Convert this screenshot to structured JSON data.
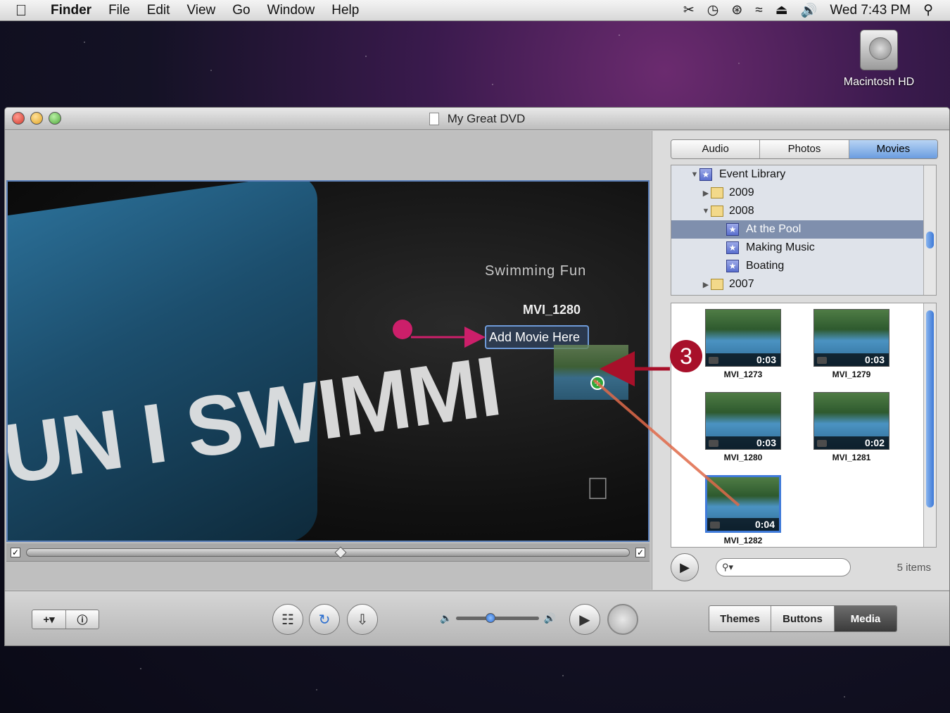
{
  "menubar": {
    "app": "Finder",
    "items": [
      "File",
      "Edit",
      "View",
      "Go",
      "Window",
      "Help"
    ],
    "clock": "Wed 7:43 PM"
  },
  "desktop": {
    "disk_label": "Macintosh HD"
  },
  "window": {
    "title": "My Great DVD"
  },
  "preview": {
    "menu_title": "Swimming Fun",
    "menu_item": "MVI_1280",
    "drop_zone": "Add Movie Here",
    "theme_text": "UN I SWIMMI"
  },
  "media": {
    "tabs": [
      "Audio",
      "Photos",
      "Movies"
    ],
    "active_tab": "Movies",
    "tree": {
      "root": "Event Library",
      "y2009": "2009",
      "y2008": "2008",
      "events": [
        "At the Pool",
        "Making Music",
        "Boating"
      ],
      "y2007": "2007"
    },
    "movies": [
      {
        "name": "MVI_1273",
        "duration": "0:03"
      },
      {
        "name": "MVI_1279",
        "duration": "0:03"
      },
      {
        "name": "MVI_1280",
        "duration": "0:03"
      },
      {
        "name": "MVI_1281",
        "duration": "0:02"
      },
      {
        "name": "MVI_1282",
        "duration": "0:04"
      }
    ],
    "item_count": "5 items"
  },
  "toolbar": {
    "segments": [
      "Themes",
      "Buttons",
      "Media"
    ],
    "active": "Media"
  },
  "callout": {
    "step": "3"
  },
  "colors": {
    "accent": "#3f7ad9",
    "callout": "#a8102a",
    "arrow": "#cc1f6a"
  }
}
